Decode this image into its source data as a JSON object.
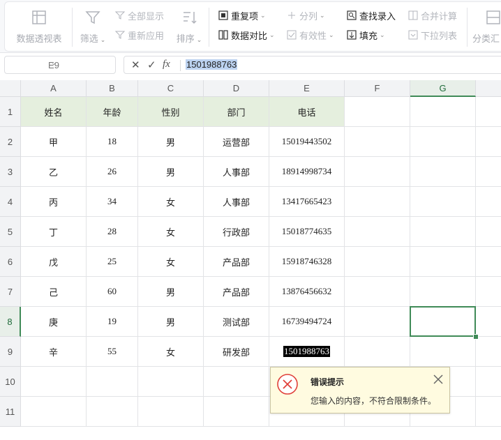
{
  "ribbon": {
    "pivot_table": "数据透视表",
    "filter": "筛选",
    "show_all": "全部显示",
    "reapply": "重新应用",
    "sort": "排序",
    "duplicates": "重复项",
    "compare": "数据对比",
    "split": "分列",
    "validity": "有效性",
    "find_entry": "查找录入",
    "fill": "填充",
    "merge_calc": "合并计算",
    "dropdown_list": "下拉列表",
    "subtotal": "分类汇"
  },
  "formula_bar": {
    "name_box": "E9",
    "cancel": "✕",
    "confirm": "✓",
    "fx": "fx",
    "value": "1501988763"
  },
  "columns": [
    "A",
    "B",
    "C",
    "D",
    "E",
    "F",
    "G"
  ],
  "rows": [
    "1",
    "2",
    "3",
    "4",
    "5",
    "6",
    "7",
    "8",
    "9",
    "10",
    "11"
  ],
  "table": {
    "headers": [
      "姓名",
      "年龄",
      "性别",
      "部门",
      "电话"
    ],
    "data": [
      [
        "甲",
        "18",
        "男",
        "运营部",
        "15019443502"
      ],
      [
        "乙",
        "26",
        "男",
        "人事部",
        "18914998734"
      ],
      [
        "丙",
        "34",
        "女",
        "人事部",
        "13417665423"
      ],
      [
        "丁",
        "28",
        "女",
        "行政部",
        "15018774635"
      ],
      [
        "戊",
        "25",
        "女",
        "产品部",
        "15918746328"
      ],
      [
        "己",
        "60",
        "男",
        "产品部",
        "13876456632"
      ],
      [
        "庚",
        "19",
        "男",
        "测试部",
        "16739494724"
      ],
      [
        "辛",
        "55",
        "女",
        "研发部",
        "1501988763"
      ]
    ]
  },
  "error_tip": {
    "title": "错误提示",
    "message": "您输入的内容，不符合限制条件。"
  },
  "colors": {
    "header_fill": "#e5efde",
    "selection": "#3f8a57",
    "tip_bg": "#fffbe0",
    "error_red": "#e0403a"
  }
}
